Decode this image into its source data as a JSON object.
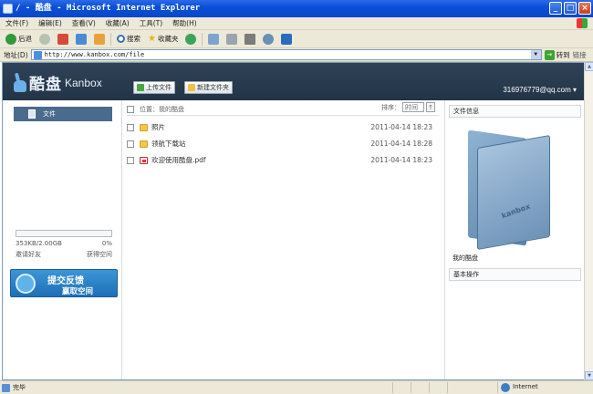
{
  "window": {
    "title": "/ - 酷盘 - Microsoft Internet Explorer"
  },
  "menu": [
    "文件(F)",
    "编辑(E)",
    "查看(V)",
    "收藏(A)",
    "工具(T)",
    "帮助(H)"
  ],
  "toolbar": {
    "back": "后退",
    "search": "搜索",
    "favorites": "收藏夹"
  },
  "address": {
    "label": "地址(D)",
    "url": "http://www.kanbox.com/file",
    "go": "转到",
    "links": "链接"
  },
  "header": {
    "logo_cn": "酷盘",
    "logo_en": "Kanbox",
    "upload": "上传文件",
    "new_folder": "新建文件夹",
    "user": "316976779@qq.com"
  },
  "sidebar": {
    "item": "文件",
    "quota_used": "353KB/2.00GB",
    "quota_pct": "0%",
    "invite": "邀请好友",
    "get_space": "获得空间",
    "feedback_1": "提交反馈",
    "feedback_2": "赢取空间"
  },
  "list": {
    "location": "位置：我的酷盘",
    "sort_label": "排序：",
    "sort_value": "时间",
    "rows": [
      {
        "name": "照片",
        "type": "folder",
        "date": "2011-04-14 18:23"
      },
      {
        "name": "领航下载站",
        "type": "folder",
        "date": "2011-04-14 18:28"
      },
      {
        "name": "欢迎使用酷盘.pdf",
        "type": "pdf",
        "date": "2011-04-14 18:23"
      }
    ]
  },
  "info": {
    "title": "文件信息",
    "folder_label": "kanbox",
    "name": "我的酷盘",
    "ops": "基本操作"
  },
  "status": {
    "text": "完毕",
    "zone": "Internet"
  }
}
